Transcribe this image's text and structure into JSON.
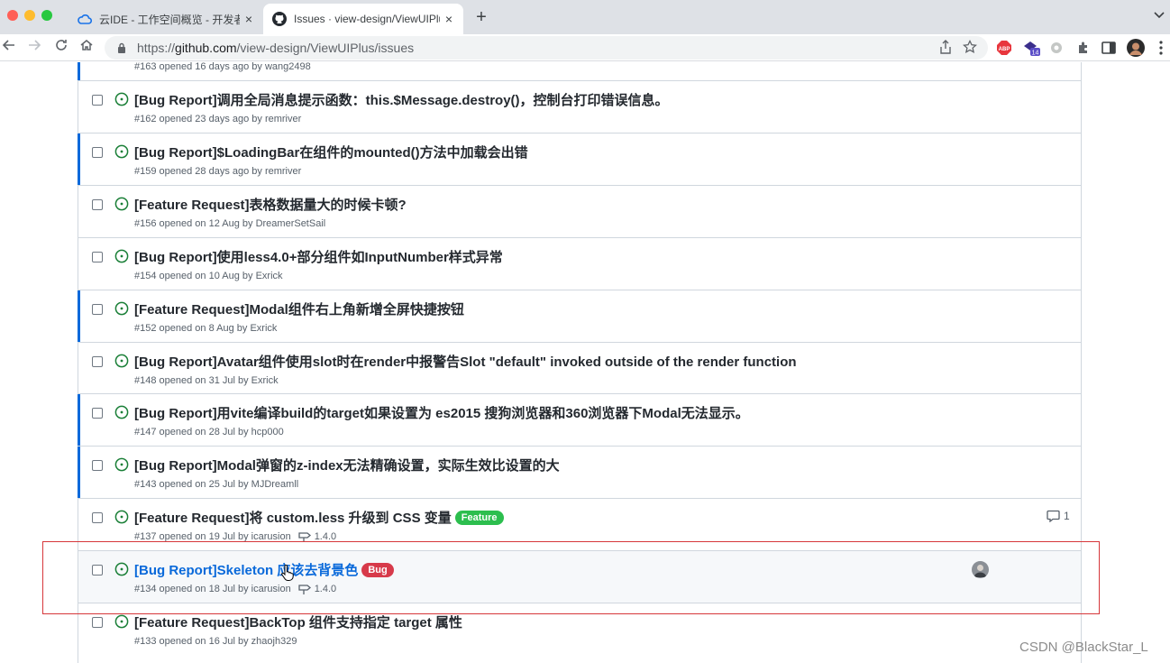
{
  "browser": {
    "tabs": [
      {
        "title": "云IDE - 工作空间概览 - 开发者云",
        "close": "×"
      },
      {
        "title": "Issues · view-design/ViewUIPlu",
        "close": "×"
      }
    ],
    "new_tab": "+",
    "url_prefix": "https://",
    "url_host": "github.com",
    "url_path": "/view-design/ViewUIPlus/issues",
    "extension_badge": "14",
    "abp_label": "ABP"
  },
  "issues": [
    {
      "title": "",
      "meta": "#163 opened 16 days ago by wang2498",
      "accent": true
    },
    {
      "title": "[Bug Report]调用全局消息提示函数：this.$Message.destroy()，控制台打印错误信息。",
      "meta": "#162 opened 23 days ago by remriver",
      "accent": false
    },
    {
      "title": "[Bug Report]$LoadingBar在组件的mounted()方法中加载会出错",
      "meta": "#159 opened 28 days ago by remriver",
      "accent": true
    },
    {
      "title": "[Feature Request]表格数据量大的时候卡顿?",
      "meta": "#156 opened on 12 Aug by DreamerSetSail",
      "accent": false
    },
    {
      "title": "[Bug Report]使用less4.0+部分组件如InputNumber样式异常",
      "meta": "#154 opened on 10 Aug by Exrick",
      "accent": false
    },
    {
      "title": "[Feature Request]Modal组件右上角新增全屏快捷按钮",
      "meta": "#152 opened on 8 Aug by Exrick",
      "accent": true
    },
    {
      "title": "[Bug Report]Avatar组件使用slot时在render中报警告Slot \"default\" invoked outside of the render function",
      "meta": "#148 opened on 31 Jul by Exrick",
      "accent": false
    },
    {
      "title": "[Bug Report]用vite编译build的target如果设置为 es2015 搜狗浏览器和360浏览器下Modal无法显示。",
      "meta": "#147 opened on 28 Jul by hcp000",
      "accent": true
    },
    {
      "title": "[Bug Report]Modal弹窗的z-index无法精确设置，实际生效比设置的大",
      "meta": "#143 opened on 25 Jul by MJDreamll",
      "accent": true
    },
    {
      "title": "[Feature Request]将 custom.less 升级到 CSS 变量",
      "meta": "#137 opened on 19 Jul by icarusion",
      "accent": false,
      "label": "Feature",
      "label_color": "#2cbe4e",
      "milestone": "1.4.0",
      "comments": "1"
    },
    {
      "title": "[Bug Report]Skeleton 应该去背景色",
      "meta": "#134 opened on 18 Jul by icarusion",
      "accent": false,
      "label": "Bug",
      "label_color": "#d73a4a",
      "milestone": "1.4.0",
      "hovered": true
    },
    {
      "title": "[Feature Request]BackTop 组件支持指定 target 属性",
      "meta": "#133 opened on 16 Jul by zhaojh329",
      "accent": false
    }
  ],
  "watermark": "CSDN @BlackStar_L",
  "colors": {
    "open_green": "#1a7f37",
    "link_blue": "#0969da",
    "highlight_red": "#d6373a"
  }
}
